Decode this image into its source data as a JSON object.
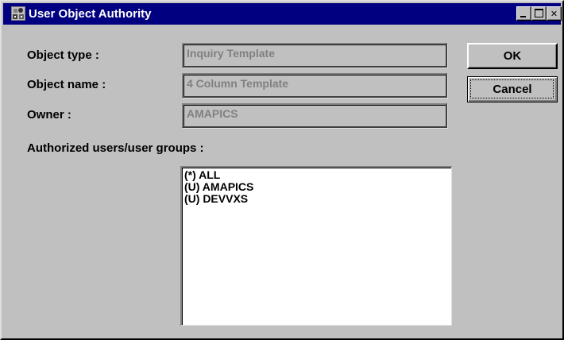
{
  "window": {
    "title": "User Object Authority"
  },
  "form": {
    "object_type_label": "Object type :",
    "object_type_value": "Inquiry Template",
    "object_name_label": "Object name :",
    "object_name_value": "4 Column Template",
    "owner_label": "Owner :",
    "owner_value": "AMAPICS",
    "authorized_label": "Authorized users/user groups :"
  },
  "authorized_users": [
    "(*) ALL",
    "(U) AMAPICS",
    "(U) DEVVXS"
  ],
  "buttons": {
    "ok_label": "OK",
    "cancel_label": "Cancel"
  },
  "icons": {
    "app": "user-object-authority-icon",
    "minimize": "minimize-icon",
    "maximize": "maximize-icon",
    "close": "close-icon"
  },
  "colors": {
    "titlebar": "#000080",
    "window_face": "#c0c0c0",
    "disabled_text": "#808080"
  }
}
